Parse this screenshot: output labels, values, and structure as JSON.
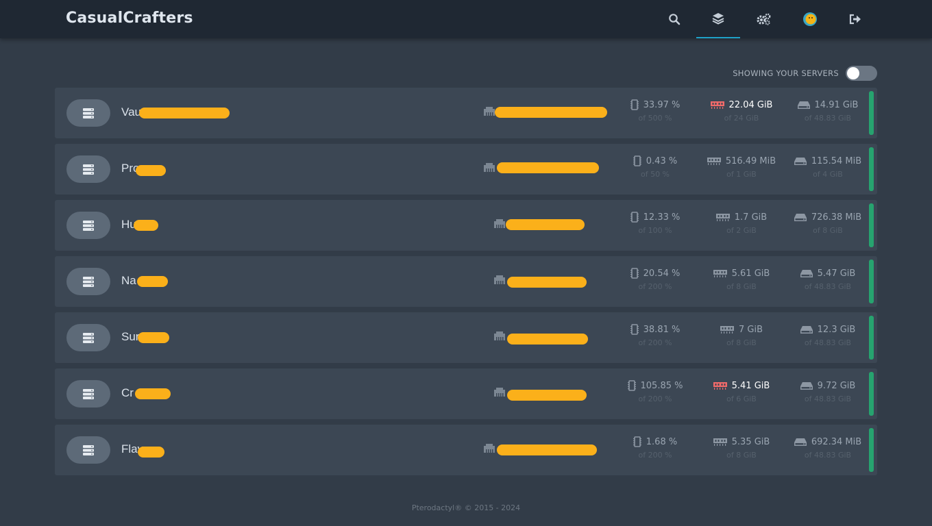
{
  "app": {
    "brand": "CasualCrafters"
  },
  "nav": {
    "icons": [
      "search-icon",
      "layers-icon",
      "cogs-icon",
      "avatar-icon",
      "sign-out-icon"
    ],
    "active": "layers-icon",
    "accent": "#1ea2c8"
  },
  "filter": {
    "label": "SHOWING YOUR SERVERS",
    "toggle_on": false
  },
  "colors": {
    "background": "#323c48",
    "row": "#3c4754",
    "status_running": "#27a36f",
    "memory_alert": "#f16a6a",
    "redaction": "#fbb01a"
  },
  "servers": [
    {
      "name": "Vau",
      "cpu": "33.97 %",
      "cpu_limit": "of 500 %",
      "memory": "22.04 GiB",
      "memory_limit": "of 24 GiB",
      "memory_alert": true,
      "disk": "14.91 GiB",
      "disk_limit": "of 48.83 GiB",
      "status": "running"
    },
    {
      "name": "Pro",
      "cpu": "0.43 %",
      "cpu_limit": "of 50 %",
      "memory": "516.49 MiB",
      "memory_limit": "of 1 GiB",
      "memory_alert": false,
      "disk": "115.54 MiB",
      "disk_limit": "of 4 GiB",
      "status": "running"
    },
    {
      "name": "Hu",
      "cpu": "12.33 %",
      "cpu_limit": "of 100 %",
      "memory": "1.7 GiB",
      "memory_limit": "of 2 GiB",
      "memory_alert": false,
      "disk": "726.38 MiB",
      "disk_limit": "of 8 GiB",
      "status": "running"
    },
    {
      "name": "Na",
      "cpu": "20.54 %",
      "cpu_limit": "of 200 %",
      "memory": "5.61 GiB",
      "memory_limit": "of 8 GiB",
      "memory_alert": false,
      "disk": "5.47 GiB",
      "disk_limit": "of 48.83 GiB",
      "status": "running"
    },
    {
      "name": "Sur",
      "cpu": "38.81 %",
      "cpu_limit": "of 200 %",
      "memory": "7 GiB",
      "memory_limit": "of 8 GiB",
      "memory_alert": false,
      "disk": "12.3 GiB",
      "disk_limit": "of 48.83 GiB",
      "status": "running"
    },
    {
      "name": "Cr",
      "cpu": "105.85 %",
      "cpu_limit": "of 200 %",
      "memory": "5.41 GiB",
      "memory_limit": "of 6 GiB",
      "memory_alert": true,
      "disk": "9.72 GiB",
      "disk_limit": "of 48.83 GiB",
      "status": "running"
    },
    {
      "name": "Flav",
      "cpu": "1.68 %",
      "cpu_limit": "of 200 %",
      "memory": "5.35 GiB",
      "memory_limit": "of 8 GiB",
      "memory_alert": false,
      "disk": "692.34 MiB",
      "disk_limit": "of 48.83 GiB",
      "status": "running"
    }
  ],
  "footer": {
    "text": "Pterodactyl® © 2015 - 2024"
  }
}
